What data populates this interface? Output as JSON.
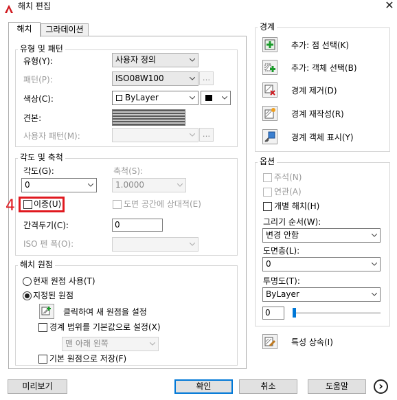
{
  "window": {
    "title": "해치 편집",
    "close_glyph": "✕"
  },
  "tabs": [
    {
      "label": "해치"
    },
    {
      "label": "그라데이션"
    }
  ],
  "type_pattern": {
    "title": "유형 및 패턴",
    "type_label": "유형(Y):",
    "type_value": "사용자 정의",
    "pattern_label": "패턴(P):",
    "pattern_value": "ISO08W100",
    "pattern_browse": "...",
    "color_label": "색상(C):",
    "color_value": "ByLayer",
    "color_swatch": "#000000",
    "swatch_label": "견본:",
    "custom_label": "사용자 패턴(M):",
    "custom_browse": "..."
  },
  "angle_scale": {
    "title": "각도 및 축척",
    "angle_label": "각도(G):",
    "angle_value": "0",
    "scale_label": "축척(S):",
    "scale_value": "1.0000",
    "double_label": "이중(U)",
    "paper_label": "도면 공간에 상대적(E)",
    "spacing_label": "간격두기(C):",
    "spacing_value": "0",
    "iso_label": "ISO 펜 폭(O):"
  },
  "annotation": {
    "number": "4",
    "color": "#e0191f"
  },
  "origin": {
    "title": "해치 원점",
    "current_label": "현재 원점 사용(T)",
    "specified_label": "지정된 원점",
    "click_set_label": "클릭하여 새 원점을 설정",
    "default_extents_label": "경계 범위를 기본값으로 설정(X)",
    "position_value": "맨 아래 왼쪽",
    "store_default_label": "기본 원점으로 저장(F)"
  },
  "boundaries": {
    "title": "경계",
    "items": [
      {
        "label": "추가: 점 선택(K)",
        "icon": "pick-points-icon"
      },
      {
        "label": "추가: 객체 선택(B)",
        "icon": "select-objects-icon"
      },
      {
        "label": "경계 제거(D)",
        "icon": "remove-boundary-icon"
      },
      {
        "label": "경계 재작성(R)",
        "icon": "recreate-boundary-icon"
      },
      {
        "label": "경계 객체 표시(Y)",
        "icon": "display-boundary-icon"
      }
    ]
  },
  "options": {
    "title": "옵션",
    "annotative_label": "주석(N)",
    "associative_label": "연관(A)",
    "separate_label": "개별 해치(H)",
    "draw_order_label": "그리기 순서(W):",
    "draw_order_value": "변경 안함",
    "layer_label": "도면층(L):",
    "layer_value": "0",
    "transparency_label": "투명도(T):",
    "transparency_value": "ByLayer",
    "transparency_amount": "0",
    "transparency_fraction": 0
  },
  "inherit_label": "특성 상속(I)",
  "footer": {
    "preview_label": "미리보기",
    "ok_label": "확인",
    "cancel_label": "취소",
    "help_label": "도움말",
    "more_glyph": "›"
  },
  "colors": {
    "accent": "#0078d7",
    "highlight": "#e0191f"
  }
}
